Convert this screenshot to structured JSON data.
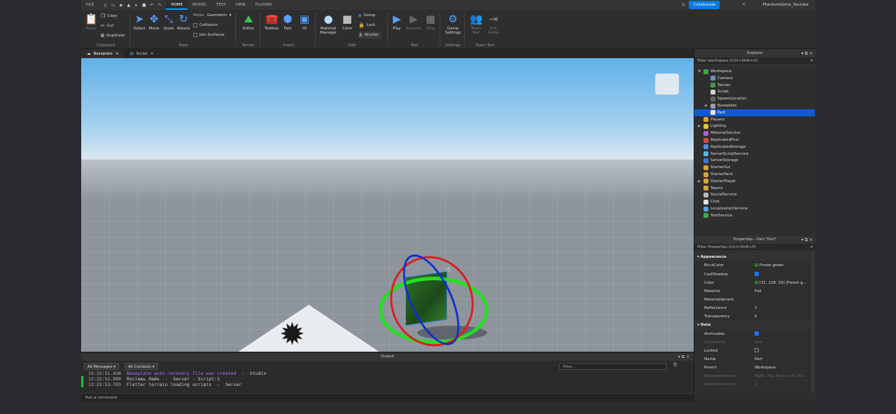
{
  "menubar": {
    "file": "FILE",
    "tabs": [
      "HOME",
      "MODEL",
      "TEST",
      "VIEW",
      "PLUGINS"
    ],
    "collaborate": "Collaborate",
    "username": "PhantomGame_Youtube"
  },
  "ribbon": {
    "clipboard": {
      "label": "Clipboard",
      "paste": "Paste",
      "copy": "Copy",
      "cut": "Cut",
      "duplicate": "Duplicate"
    },
    "tools": {
      "label": "Tools",
      "select": "Select",
      "move": "Move",
      "scale": "Scale",
      "rotate": "Rotate",
      "mode_label": "Mode:",
      "mode_value": "Geometric",
      "collisions": "Collisions",
      "join_surfaces": "Join Surfaces"
    },
    "terrain": {
      "label": "Terrain",
      "editor": "Editor"
    },
    "insert": {
      "label": "Insert",
      "toolbox": "Toolbox",
      "part": "Part",
      "ui": "UI"
    },
    "edit": {
      "label": "Edit",
      "material_manager_1": "Material",
      "material_manager_2": "Manager",
      "color": "Color",
      "group": "Group",
      "lock": "Lock",
      "anchor": "Anchor"
    },
    "test": {
      "label": "Test",
      "play": "Play",
      "resume": "Resume",
      "stop": "Stop"
    },
    "settings": {
      "label": "Settings",
      "game_settings_1": "Game",
      "game_settings_2": "Settings"
    },
    "team_test": {
      "label": "Team Test",
      "team_test_1": "Team",
      "team_test_2": "Test",
      "exit_game_1": "Exit",
      "exit_game_2": "Game"
    }
  },
  "doc_tabs": [
    {
      "label": "Baseplate"
    },
    {
      "label": "Script"
    }
  ],
  "output": {
    "title": "Output",
    "all_messages": "All Messages",
    "all_contexts": "All Contexts",
    "filter_placeholder": "Filter...",
    "lines": [
      {
        "time": "12:22:51.428",
        "message": "Baseplate auto-recovery file was created",
        "source": "  -  Studio"
      },
      {
        "time": "12:22:52.999",
        "message": "Поставь Лайк",
        "source": "  -  Server - Script:1"
      },
      {
        "time": "12:22:53.793",
        "message": "Flatter terrain loading scripts",
        "source": "  -  Server"
      }
    ],
    "command_placeholder": "Run a command"
  },
  "explorer": {
    "title": "Explorer",
    "filter": "Filter workspace (Ctrl+Shift+X)",
    "items": [
      {
        "label": "Workspace",
        "color": "#3fa84c",
        "arrow": "▼",
        "indent": 0
      },
      {
        "label": "Camera",
        "color": "#6f8fb8",
        "arrow": "",
        "indent": 1
      },
      {
        "label": "Terrain",
        "color": "#3aa04a",
        "arrow": "",
        "indent": 1
      },
      {
        "label": "Script",
        "color": "#cfcfcf",
        "arrow": "",
        "indent": 1
      },
      {
        "label": "SpawnLocation",
        "color": "#666666",
        "arrow": "",
        "indent": 1
      },
      {
        "label": "Baseplate",
        "color": "#9aa0a8",
        "arrow": "▶",
        "indent": 1
      },
      {
        "label": "Part",
        "color": "#e8e8e8",
        "arrow": "",
        "indent": 1,
        "selected": true
      },
      {
        "label": "Players",
        "color": "#d8a33a",
        "arrow": "",
        "indent": 0
      },
      {
        "label": "Lighting",
        "color": "#e7c03a",
        "arrow": "▶",
        "indent": 0
      },
      {
        "label": "MaterialService",
        "color": "#b05fd0",
        "arrow": "",
        "indent": 0
      },
      {
        "label": "ReplicatedFirst",
        "color": "#d04a4a",
        "arrow": "",
        "indent": 0
      },
      {
        "label": "ReplicatedStorage",
        "color": "#5a8ad8",
        "arrow": "",
        "indent": 0
      },
      {
        "label": "ServerScriptService",
        "color": "#58b4e0",
        "arrow": "",
        "indent": 0
      },
      {
        "label": "ServerStorage",
        "color": "#3a78d0",
        "arrow": "",
        "indent": 0
      },
      {
        "label": "StarterGui",
        "color": "#d8a33a",
        "arrow": "",
        "indent": 0
      },
      {
        "label": "StarterPack",
        "color": "#d8a33a",
        "arrow": "",
        "indent": 0
      },
      {
        "label": "StarterPlayer",
        "color": "#d8a33a",
        "arrow": "▶",
        "indent": 0
      },
      {
        "label": "Teams",
        "color": "#d8a33a",
        "arrow": "",
        "indent": 0
      },
      {
        "label": "SoundService",
        "color": "#b8b8b8",
        "arrow": "",
        "indent": 0
      },
      {
        "label": "Chat",
        "color": "#e0e0e0",
        "arrow": "",
        "indent": 0
      },
      {
        "label": "LocalizationService",
        "color": "#58a0e0",
        "arrow": "",
        "indent": 0
      },
      {
        "label": "TestService",
        "color": "#3fa84c",
        "arrow": "",
        "indent": 0
      }
    ]
  },
  "properties": {
    "title": "Properties - Part \"Part\"",
    "filter": "Filter Properties (Ctrl+Shift+P)",
    "sections": {
      "appearance": "Appearance",
      "data": "Data"
    },
    "appearance_rows": [
      {
        "name": "BrickColor",
        "value": "Forest green",
        "swatch": "#1f801d"
      },
      {
        "name": "CastShadow",
        "checkbox": true
      },
      {
        "name": "Color",
        "value": "[31, 128, 29] [Forest g...",
        "swatch": "#1f801d"
      },
      {
        "name": "Material",
        "value": "Foil"
      },
      {
        "name": "MaterialVariant",
        "value": ""
      },
      {
        "name": "Reflectance",
        "value": "1"
      },
      {
        "name": "Transparency",
        "value": "0"
      }
    ],
    "data_rows": [
      {
        "name": "Archivable",
        "checkbox": true
      },
      {
        "name": "ClassName",
        "value": "Part",
        "dim": true
      },
      {
        "name": "Locked",
        "checkbox": false
      },
      {
        "name": "Name",
        "value": "Part"
      },
      {
        "name": "Parent",
        "value": "Workspace"
      },
      {
        "name": "ResizeableFaces",
        "value": "Right, Top, Back, Left, Bo...",
        "dim": true
      },
      {
        "name": "ResizeIncrement",
        "value": "1",
        "dim": true
      }
    ]
  },
  "colors": {
    "accent": "#0f5ad2",
    "collaborate": "#0a7ae0",
    "part": "#1f801d"
  }
}
